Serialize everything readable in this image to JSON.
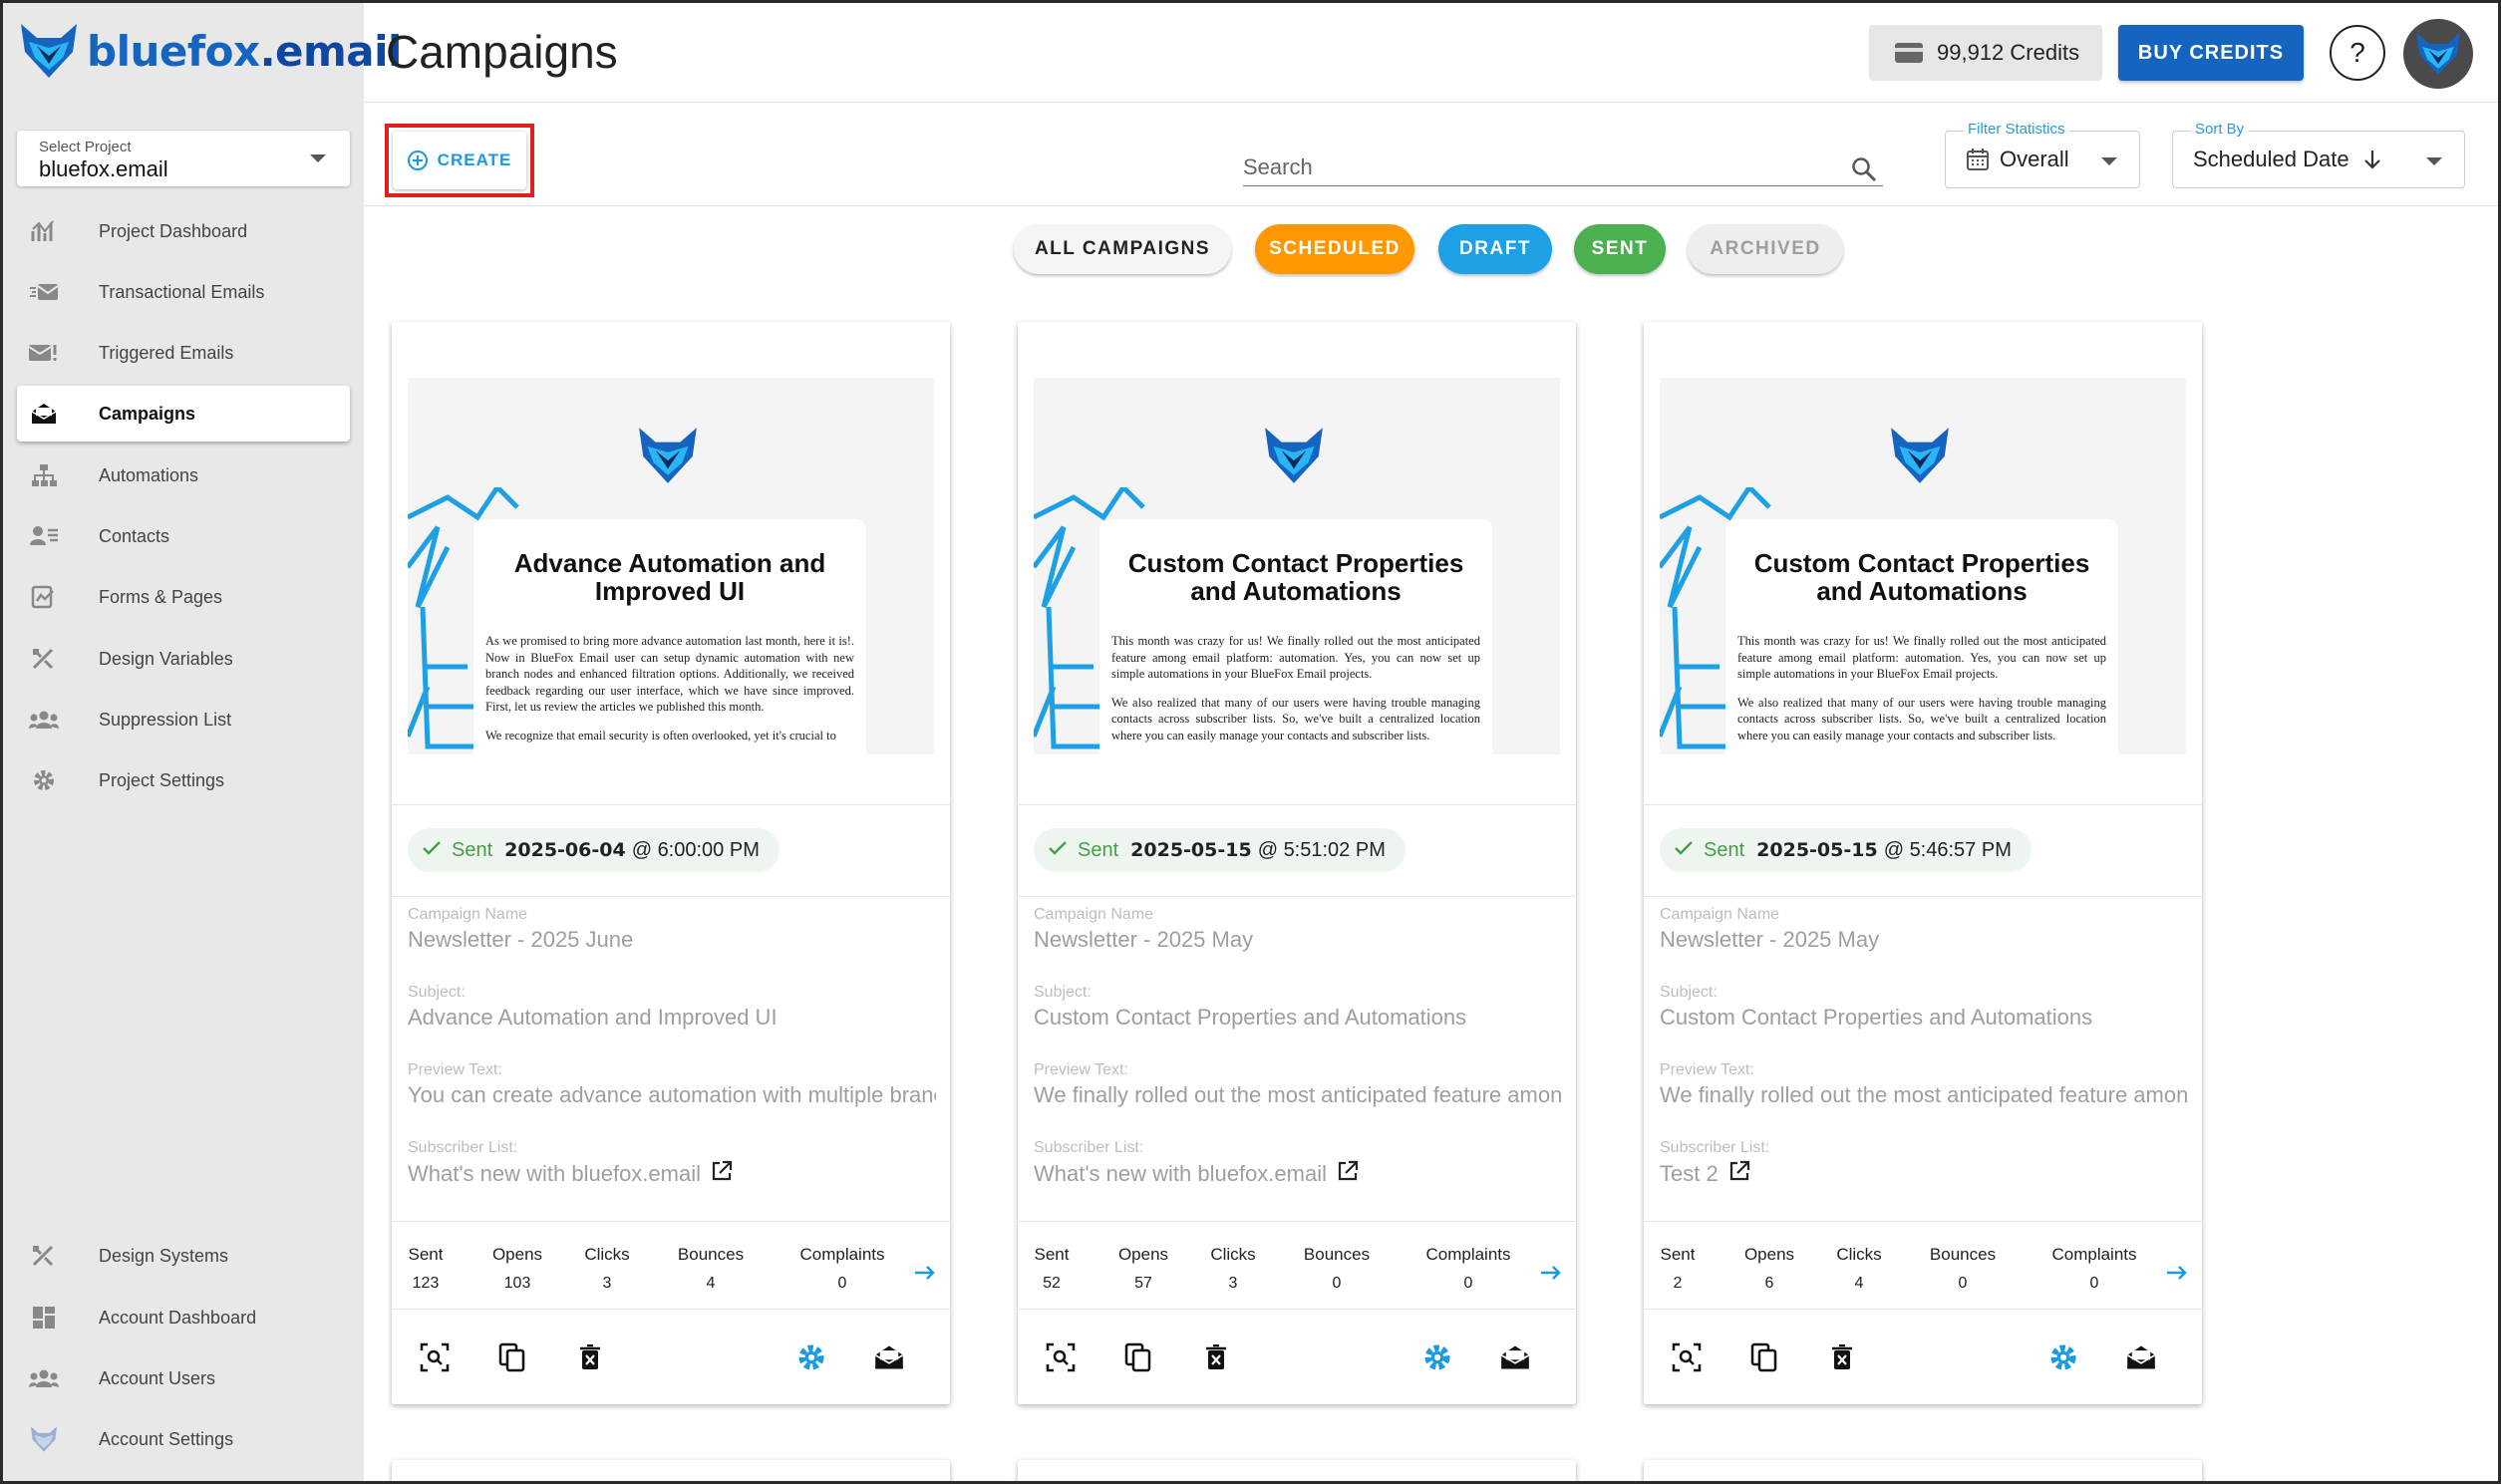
{
  "app": {
    "logo_text": "bluefox",
    "logo_suffix": ".email"
  },
  "sidebar": {
    "project_select": {
      "label": "Select Project",
      "value": "bluefox.email"
    },
    "items": [
      {
        "label": "Project Dashboard",
        "icon": "chart-icon"
      },
      {
        "label": "Transactional Emails",
        "icon": "email-fast-icon"
      },
      {
        "label": "Triggered Emails",
        "icon": "email-alert-icon"
      },
      {
        "label": "Campaigns",
        "icon": "email-open-icon",
        "active": true
      },
      {
        "label": "Automations",
        "icon": "sitemap-icon"
      },
      {
        "label": "Contacts",
        "icon": "contacts-icon"
      },
      {
        "label": "Forms & Pages",
        "icon": "forms-icon"
      },
      {
        "label": "Design Variables",
        "icon": "design-tools-icon"
      },
      {
        "label": "Suppression List",
        "icon": "account-group-icon"
      },
      {
        "label": "Project Settings",
        "icon": "gear-icon"
      }
    ],
    "bottom_items": [
      {
        "label": "Design Systems",
        "icon": "design-tools-icon"
      },
      {
        "label": "Account Dashboard",
        "icon": "dashboard-icon"
      },
      {
        "label": "Account Users",
        "icon": "account-group-icon"
      },
      {
        "label": "Account Settings",
        "icon": "fox-icon"
      }
    ]
  },
  "header": {
    "title": "Campaigns",
    "credits": "99,912 Credits",
    "buy_credits": "BUY CREDITS",
    "help": "?"
  },
  "toolbar": {
    "create_label": "CREATE",
    "search_placeholder": "Search",
    "filter_statistics": {
      "label": "Filter Statistics",
      "value": "Overall"
    },
    "sort_by": {
      "label": "Sort By",
      "value": "Scheduled Date"
    }
  },
  "filters": [
    {
      "label": "ALL CAMPAIGNS",
      "bg": "#f5f5f5",
      "color": "#222222"
    },
    {
      "label": "SCHEDULED",
      "bg": "#ff9800",
      "color": "#ffffff"
    },
    {
      "label": "DRAFT",
      "bg": "#1ea0e6",
      "color": "#ffffff"
    },
    {
      "label": "SENT",
      "bg": "#4caf50",
      "color": "#ffffff"
    },
    {
      "label": "ARCHIVED",
      "bg": "#eeeeee",
      "color": "#9e9e9e"
    }
  ],
  "field_labels": {
    "campaign_name": "Campaign Name",
    "subject": "Subject:",
    "preview_text": "Preview Text:",
    "subscriber_list": "Subscriber List:"
  },
  "stat_labels": [
    "Sent",
    "Opens",
    "Clicks",
    "Bounces",
    "Complaints"
  ],
  "campaigns": [
    {
      "preview_title": "Advance Automation and Improved UI",
      "preview_body": [
        "As we promised to bring more advance automation last month, here it is!. Now in BlueFox Email user can setup dynamic automation with new branch nodes and enhanced filtration options. Additionally, we received feedback regarding our user interface, which we have since improved. First, let us review the articles we published this month.",
        "We recognize that email security is often overlooked, yet it's crucial to"
      ],
      "status": "Sent",
      "date": "2025-06-04",
      "time": "@ 6:00:00 PM",
      "name": "Newsletter - 2025 June",
      "subject": "Advance Automation and Improved UI",
      "preview_text": "You can create advance automation with multiple branches",
      "subscriber_list": "What's new with bluefox.email",
      "stats": {
        "sent": "123",
        "opens": "103",
        "clicks": "3",
        "bounces": "4",
        "complaints": "0"
      }
    },
    {
      "preview_title": "Custom Contact Properties and Automations",
      "preview_body": [
        "This month was crazy for us! We finally rolled out the most anticipated feature among email platform: automation. Yes, you can now set up simple automations in your BlueFox Email projects.",
        "We also realized that many of our users were having trouble managing contacts across subscriber lists. So, we've built a centralized location where you can easily manage your contacts and subscriber lists."
      ],
      "status": "Sent",
      "date": "2025-05-15",
      "time": "@ 5:51:02 PM",
      "name": "Newsletter - 2025 May",
      "subject": "Custom Contact Properties and Automations",
      "preview_text": "We finally rolled out the most anticipated feature among email platforms",
      "subscriber_list": "What's new with bluefox.email",
      "stats": {
        "sent": "52",
        "opens": "57",
        "clicks": "3",
        "bounces": "0",
        "complaints": "0"
      }
    },
    {
      "preview_title": "Custom Contact Properties and Automations",
      "preview_body": [
        "This month was crazy for us! We finally rolled out the most anticipated feature among email platform: automation. Yes, you can now set up simple automations in your BlueFox Email projects.",
        "We also realized that many of our users were having trouble managing contacts across subscriber lists. So, we've built a centralized location where you can easily manage your contacts and subscriber lists."
      ],
      "status": "Sent",
      "date": "2025-05-15",
      "time": "@ 5:46:57 PM",
      "name": "Newsletter - 2025 May",
      "subject": "Custom Contact Properties and Automations",
      "preview_text": "We finally rolled out the most anticipated feature among email platforms",
      "subscriber_list": "Test 2",
      "stats": {
        "sent": "2",
        "opens": "6",
        "clicks": "4",
        "bounces": "0",
        "complaints": "0"
      }
    }
  ],
  "colors": {
    "brand": "#1565c0",
    "accent": "#1a9ae0",
    "sent": "#43a047",
    "highlight": "#e02020"
  }
}
